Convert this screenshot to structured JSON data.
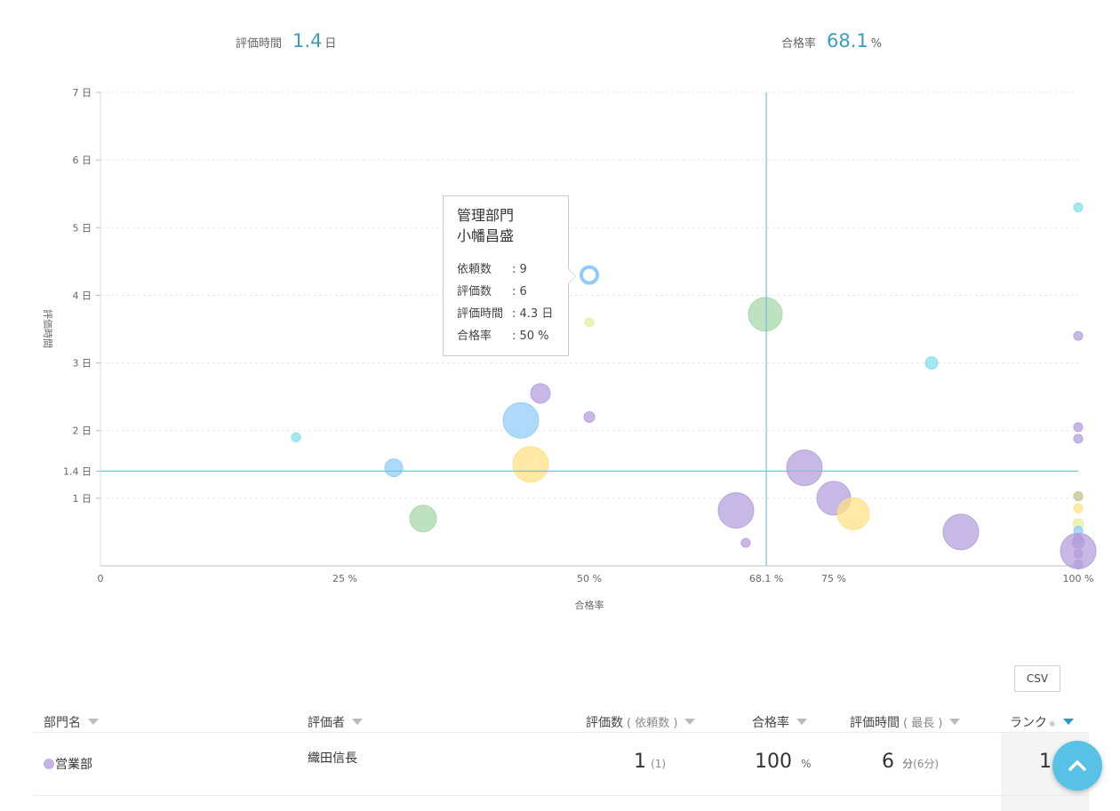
{
  "summary": {
    "time_label": "評価時間",
    "time_value": "1.4",
    "time_unit": "日",
    "rate_label": "合格率",
    "rate_value": "68.1",
    "rate_unit": "%"
  },
  "chart_data": {
    "type": "scatter",
    "xlabel": "合格率",
    "ylabel": "評価時間",
    "xlim": [
      0,
      100
    ],
    "ylim": [
      0,
      7
    ],
    "x_ticks": [
      "0",
      "25 %",
      "50 %",
      "68.1 %",
      "75 %",
      "100 %"
    ],
    "y_ticks": [
      "1 日",
      "1.4 日",
      "2 日",
      "3 日",
      "4 日",
      "5 日",
      "6 日",
      "7 日"
    ],
    "reference_lines": {
      "x": 68.1,
      "y": 1.4,
      "color": "#72c4d9"
    },
    "colors": {
      "purple": "#b39ddb",
      "blue": "#90caf9",
      "green": "#a5d6a7",
      "yellow": "#ffe082",
      "cyan": "#80deea",
      "lime": "#e6ee9c",
      "olive": "#c5c08a"
    },
    "points": [
      {
        "x": 20,
        "y": 1.9,
        "r": 5,
        "color": "cyan"
      },
      {
        "x": 30,
        "y": 1.45,
        "r": 10,
        "color": "blue"
      },
      {
        "x": 33,
        "y": 0.7,
        "r": 15,
        "color": "green"
      },
      {
        "x": 43,
        "y": 2.15,
        "r": 20,
        "color": "blue"
      },
      {
        "x": 44,
        "y": 1.5,
        "r": 20,
        "color": "yellow"
      },
      {
        "x": 45,
        "y": 2.55,
        "r": 11,
        "color": "purple"
      },
      {
        "x": 50,
        "y": 2.2,
        "r": 6,
        "color": "purple"
      },
      {
        "x": 50,
        "y": 3.6,
        "r": 5,
        "color": "lime"
      },
      {
        "x": 68,
        "y": 3.72,
        "r": 19,
        "color": "green"
      },
      {
        "x": 65,
        "y": 0.82,
        "r": 20,
        "color": "purple"
      },
      {
        "x": 66,
        "y": 0.34,
        "r": 5,
        "color": "purple"
      },
      {
        "x": 72,
        "y": 1.45,
        "r": 20,
        "color": "purple"
      },
      {
        "x": 75,
        "y": 1.0,
        "r": 19,
        "color": "purple"
      },
      {
        "x": 77,
        "y": 0.77,
        "r": 18,
        "color": "yellow"
      },
      {
        "x": 85,
        "y": 3.0,
        "r": 7,
        "color": "cyan"
      },
      {
        "x": 88,
        "y": 0.5,
        "r": 20,
        "color": "purple"
      },
      {
        "x": 100,
        "y": 5.3,
        "r": 5,
        "color": "cyan"
      },
      {
        "x": 100,
        "y": 3.4,
        "r": 5,
        "color": "purple"
      },
      {
        "x": 100,
        "y": 2.05,
        "r": 5,
        "color": "purple"
      },
      {
        "x": 100,
        "y": 1.88,
        "r": 5,
        "color": "purple"
      },
      {
        "x": 100,
        "y": 1.03,
        "r": 5,
        "color": "olive"
      },
      {
        "x": 100,
        "y": 0.85,
        "r": 5,
        "color": "yellow"
      },
      {
        "x": 100,
        "y": 0.62,
        "r": 6,
        "color": "lime"
      },
      {
        "x": 100,
        "y": 0.52,
        "r": 5,
        "color": "blue"
      },
      {
        "x": 100,
        "y": 0.4,
        "r": 5,
        "color": "purple"
      },
      {
        "x": 100,
        "y": 0.35,
        "r": 7,
        "color": "purple"
      },
      {
        "x": 100,
        "y": 0.18,
        "r": 5,
        "color": "purple"
      },
      {
        "x": 100,
        "y": 0.22,
        "r": 20,
        "color": "purple"
      },
      {
        "x": 100,
        "y": 0.02,
        "r": 5,
        "color": "purple"
      }
    ],
    "highlight": {
      "x": 50,
      "y": 4.3,
      "r": 9,
      "color": "#90caf9"
    }
  },
  "tooltip": {
    "dept": "管理部門",
    "name": "小幡昌盛",
    "rows": [
      {
        "label": "依頼数",
        "value": ": 9"
      },
      {
        "label": "評価数",
        "value": ": 6"
      },
      {
        "label": "評価時間",
        "value": ": 4.3 日"
      },
      {
        "label": "合格率",
        "value": ": 50 %"
      }
    ]
  },
  "table": {
    "csv_label": "CSV",
    "headers": {
      "dept": "部門名",
      "evaluator": "評価者",
      "count": "評価数",
      "count_sub": "( 依頼数 )",
      "rate": "合格率",
      "time": "評価時間",
      "time_sub": "( 最長 )",
      "rank": "ランク",
      "rank_note": "※"
    },
    "row": {
      "dept": "営業部",
      "evaluator": "織田信長",
      "count": "1",
      "count_sub": "(1)",
      "rate": "100",
      "rate_unit": "%",
      "time": "6",
      "time_unit": "分",
      "time_sub": "(6分)",
      "rank": "1"
    }
  }
}
